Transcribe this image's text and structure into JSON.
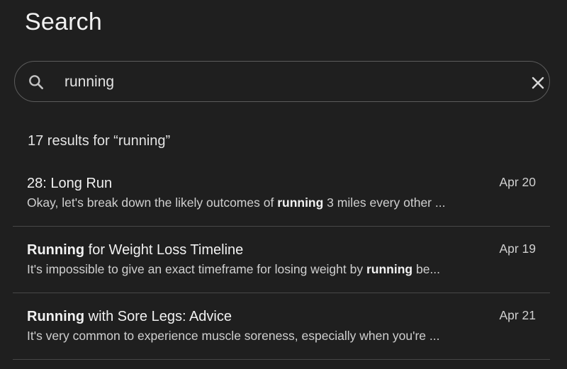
{
  "header": {
    "title": "Search"
  },
  "search": {
    "query": "running",
    "icon": "search-icon",
    "clear_icon": "close-icon"
  },
  "results": {
    "count_text": "17 results for “running”",
    "items": [
      {
        "title_parts": [
          {
            "text": "28: Long Run",
            "bold": false
          }
        ],
        "snippet_parts": [
          {
            "text": "Okay, let's break down the likely outcomes of ",
            "bold": false
          },
          {
            "text": "running",
            "bold": true
          },
          {
            "text": " 3 miles every other ...",
            "bold": false
          }
        ],
        "date": "Apr 20"
      },
      {
        "title_parts": [
          {
            "text": "Running",
            "bold": true
          },
          {
            "text": " for Weight Loss Timeline",
            "bold": false
          }
        ],
        "snippet_parts": [
          {
            "text": "It's impossible to give an exact timeframe for losing weight by ",
            "bold": false
          },
          {
            "text": "running",
            "bold": true
          },
          {
            "text": " be...",
            "bold": false
          }
        ],
        "date": "Apr 19"
      },
      {
        "title_parts": [
          {
            "text": "Running",
            "bold": true
          },
          {
            "text": " with Sore Legs: Advice",
            "bold": false
          }
        ],
        "snippet_parts": [
          {
            "text": "It's very common to experience muscle soreness, especially when you're ...",
            "bold": false
          }
        ],
        "date": "Apr 21"
      }
    ]
  }
}
